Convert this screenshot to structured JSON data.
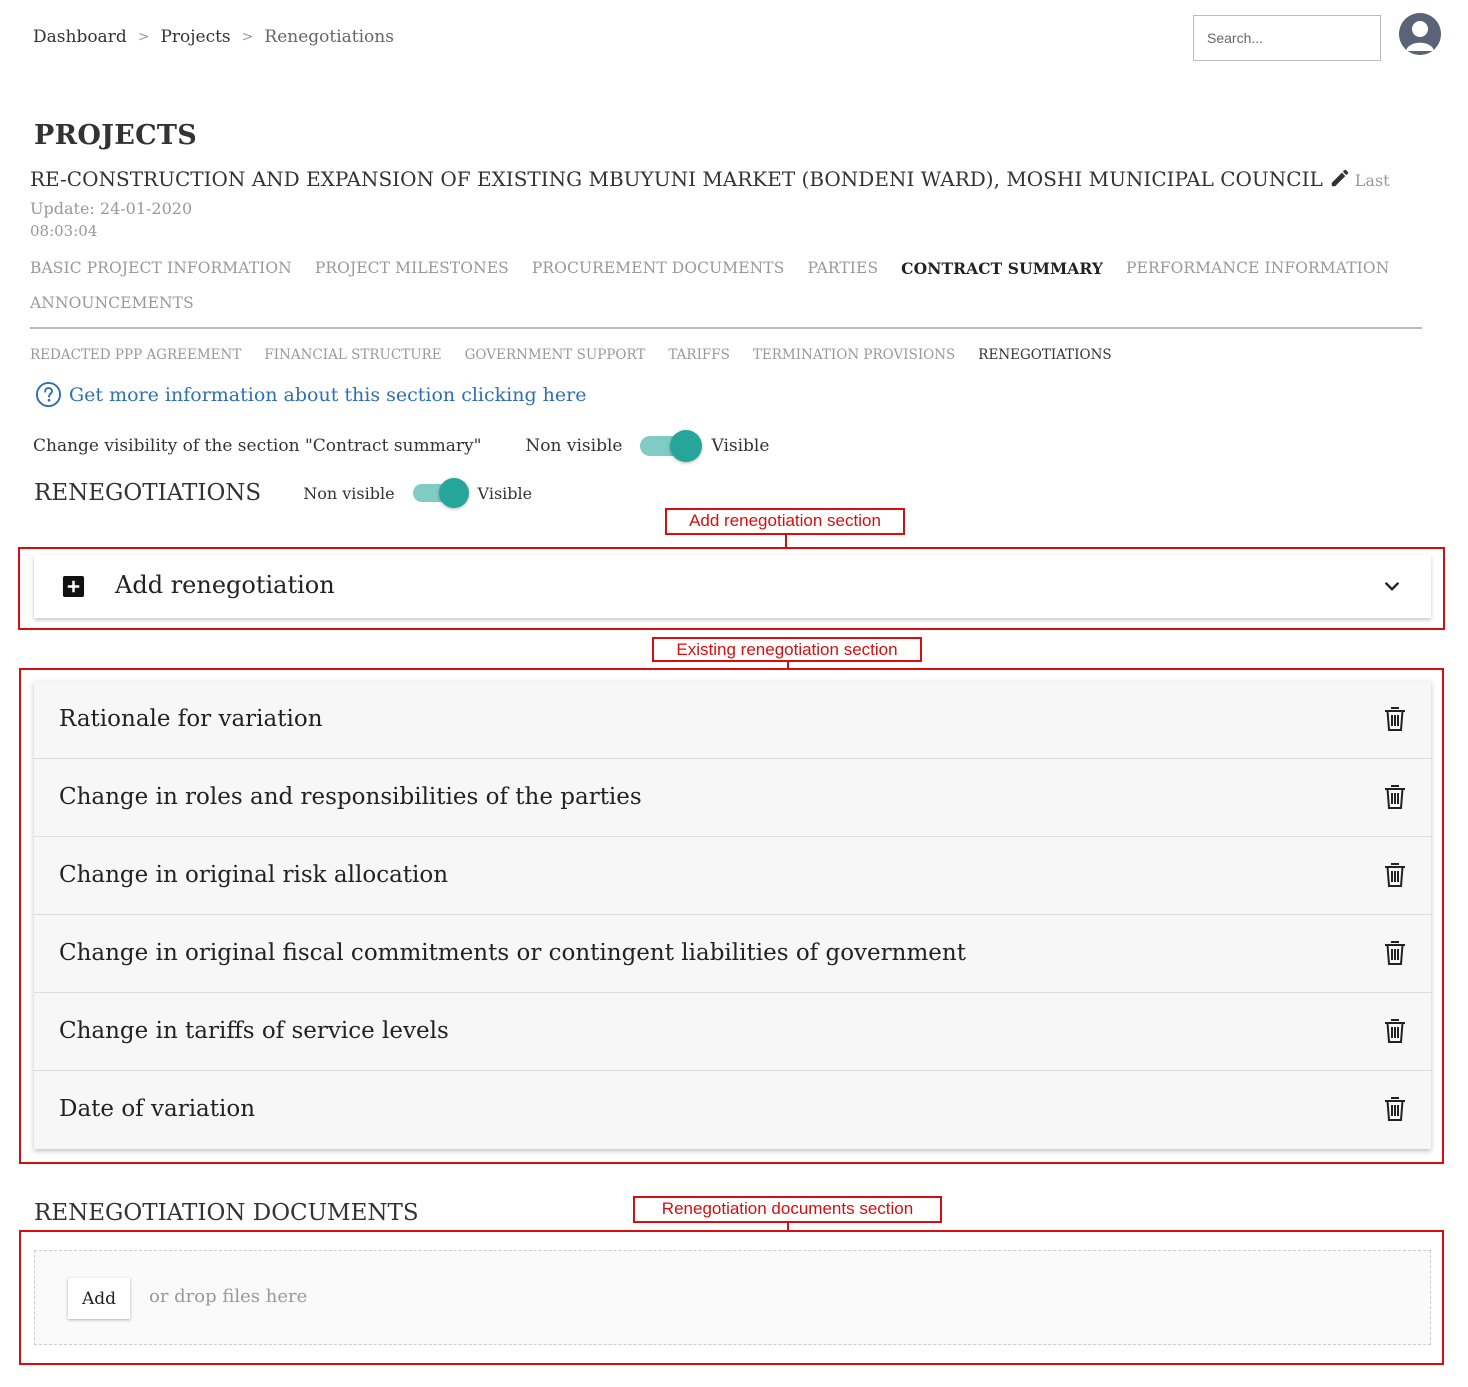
{
  "breadcrumb": {
    "items": [
      "Dashboard",
      "Projects",
      "Renegotiations"
    ],
    "separator": ">"
  },
  "search": {
    "placeholder": "Search..."
  },
  "header": {
    "title": "PROJECTS",
    "project_name": "RE-CONSTRUCTION AND EXPANSION OF EXISTING MBUYUNI MARKET (BONDENI WARD), MOSHI MUNICIPAL COUNCIL",
    "last_update_label": "Last Update: 24-01-2020",
    "last_update_time": "08:03:04"
  },
  "tabs": [
    {
      "label": "BASIC PROJECT INFORMATION",
      "active": false
    },
    {
      "label": "PROJECT MILESTONES",
      "active": false
    },
    {
      "label": "PROCUREMENT DOCUMENTS",
      "active": false
    },
    {
      "label": "PARTIES",
      "active": false
    },
    {
      "label": "CONTRACT SUMMARY",
      "active": true
    },
    {
      "label": "PERFORMANCE INFORMATION",
      "active": false
    },
    {
      "label": "ANNOUNCEMENTS",
      "active": false
    }
  ],
  "subtabs": [
    {
      "label": "REDACTED PPP AGREEMENT",
      "active": false
    },
    {
      "label": "FINANCIAL STRUCTURE",
      "active": false
    },
    {
      "label": "GOVERNMENT SUPPORT",
      "active": false
    },
    {
      "label": "TARIFFS",
      "active": false
    },
    {
      "label": "TERMINATION PROVISIONS",
      "active": false
    },
    {
      "label": "RENEGOTIATIONS",
      "active": true
    }
  ],
  "info_link": "Get more information about this section clicking here",
  "section_visibility": {
    "text": "Change visibility of the section \"Contract summary\"",
    "off_label": "Non visible",
    "on_label": "Visible",
    "checked": true
  },
  "renegotiations": {
    "heading": "RENEGOTIATIONS",
    "off_label": "Non visible",
    "on_label": "Visible",
    "checked": true
  },
  "annotations": {
    "add_section": "Add renegotiation section",
    "existing_section": "Existing renegotiation section",
    "documents_section": "Renegotiation documents section"
  },
  "add_card": {
    "label": "Add renegotiation"
  },
  "reneg_items": [
    "Rationale for variation",
    "Change in roles and responsibilities of the parties",
    "Change in original risk allocation",
    "Change in original fiscal commitments or contingent liabilities of government",
    "Change in tariffs of service levels",
    "Date of variation"
  ],
  "documents": {
    "heading": "RENEGOTIATION DOCUMENTS",
    "add_button": "Add",
    "drop_hint": "or drop files here"
  },
  "colors": {
    "accent_teal": "#26a69a",
    "toggle_track": "#80cbc4",
    "link_blue": "#2e6fb5",
    "annotation_red": "#d90d0d"
  },
  "icons": [
    "user-avatar-icon",
    "pencil-icon",
    "help-circle-icon",
    "plus-box-icon",
    "chevron-down-icon",
    "trash-icon"
  ]
}
